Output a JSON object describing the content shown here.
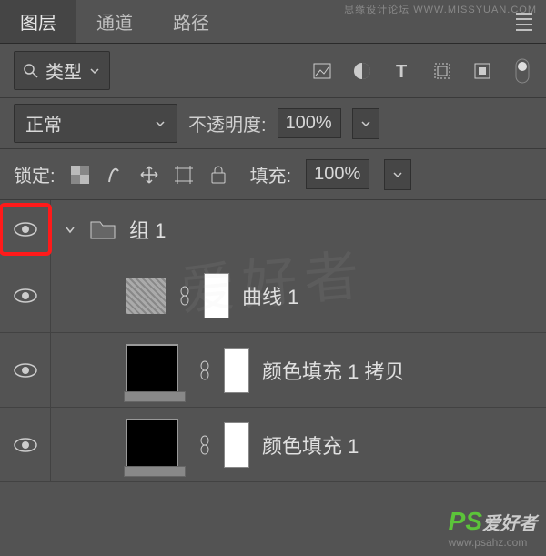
{
  "watermarks": {
    "top": "思缘设计论坛  WWW.MISSYUAN.COM",
    "center": "爱好者",
    "bottom_logo": "PS",
    "bottom_sub": "爱好者",
    "bottom_url": "www.psahz.com"
  },
  "tabs": {
    "layers": "图层",
    "channels": "通道",
    "paths": "路径"
  },
  "filter": {
    "type_label": "类型"
  },
  "blend": {
    "mode": "正常",
    "opacity_label": "不透明度:",
    "opacity_value": "100%"
  },
  "lock": {
    "label": "锁定:",
    "fill_label": "填充:",
    "fill_value": "100%"
  },
  "layers": {
    "group": "组 1",
    "curves": "曲线 1",
    "fill_copy": "颜色填充 1 拷贝",
    "fill": "颜色填充 1"
  }
}
